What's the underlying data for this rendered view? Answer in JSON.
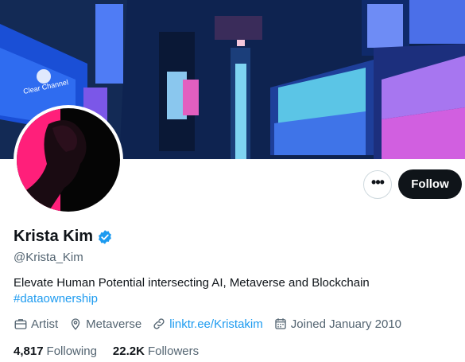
{
  "profile": {
    "name": "Krista Kim",
    "handle": "@Krista_Kim",
    "bio_text": "Elevate Human Potential intersecting AI, Metaverse and Blockchain",
    "bio_hashtag": "#dataownership",
    "category": "Artist",
    "location": "Metaverse",
    "website": "linktr.ee/Kristakim",
    "joined": "Joined January 2010",
    "following_count": "4,817",
    "following_label": "Following",
    "followers_count": "22.2K",
    "followers_label": "Followers"
  },
  "actions": {
    "more_label": "•••",
    "follow_label": "Follow"
  },
  "banner": {
    "billboard_text": "Clear Channel"
  },
  "colors": {
    "accent": "#1d9bf0",
    "follow_bg": "#0f1419",
    "secondary_text": "#536471"
  }
}
